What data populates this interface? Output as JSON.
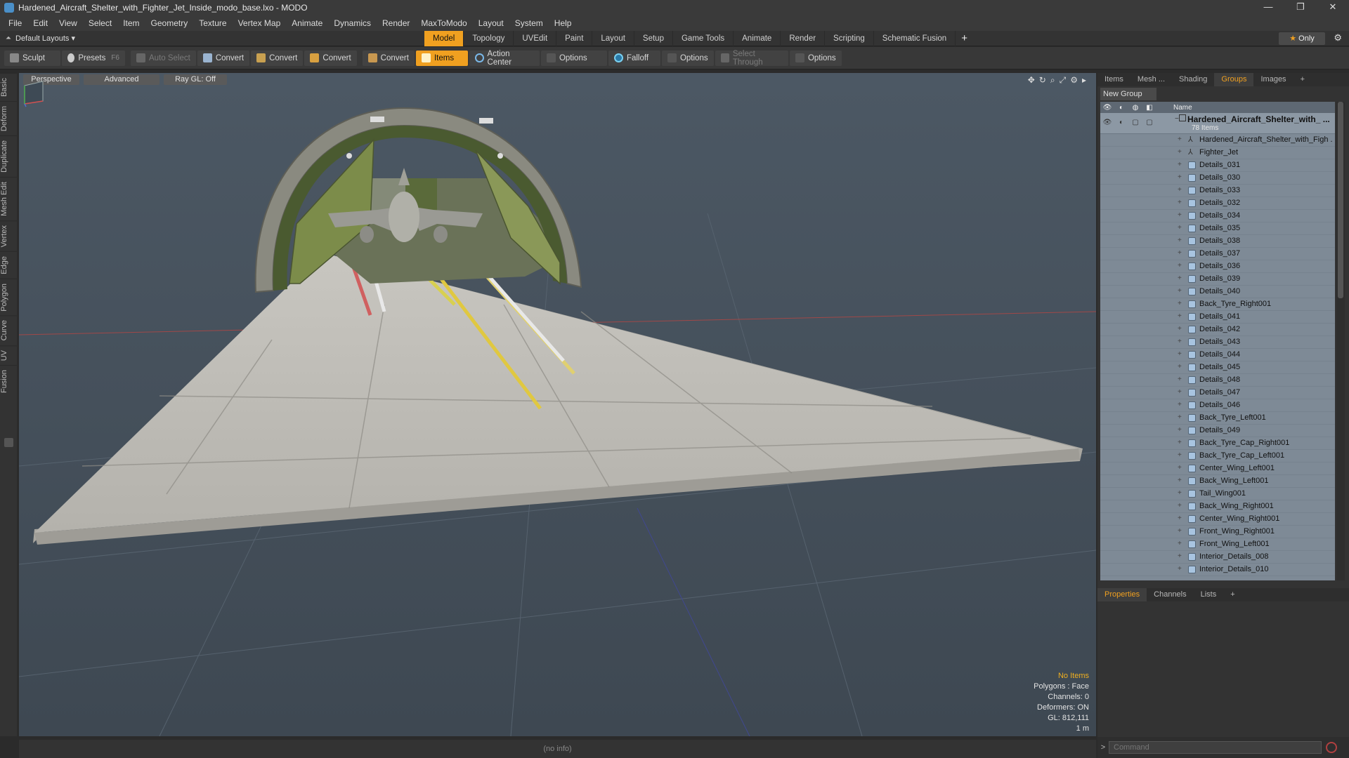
{
  "window": {
    "title": "Hardened_Aircraft_Shelter_with_Fighter_Jet_Inside_modo_base.lxo - MODO",
    "controls": [
      "—",
      "❐",
      "✕"
    ]
  },
  "menu": [
    "File",
    "Edit",
    "View",
    "Select",
    "Item",
    "Geometry",
    "Texture",
    "Vertex Map",
    "Animate",
    "Dynamics",
    "Render",
    "MaxToModo",
    "Layout",
    "System",
    "Help"
  ],
  "layoutbar": {
    "layout_name": "Default Layouts ▾",
    "tabs": [
      "Model",
      "Topology",
      "UVEdit",
      "Paint",
      "Layout",
      "Setup",
      "Game Tools",
      "Animate",
      "Render",
      "Scripting",
      "Schematic Fusion"
    ],
    "active_tab": "Model",
    "only_label": "Only"
  },
  "toolbar": {
    "sculpt": "Sculpt",
    "presets": "Presets",
    "presets_hotkey": "F6",
    "auto_select": "Auto Select",
    "convert1": "Convert",
    "convert2": "Convert",
    "convert3": "Convert",
    "convert4": "Convert",
    "items": "Items",
    "action_center": "Action Center",
    "options1": "Options",
    "falloff": "Falloff",
    "options2": "Options",
    "select_through": "Select Through",
    "options3": "Options"
  },
  "left_tabs": [
    "Basic",
    "Deform",
    "Duplicate",
    "Mesh Edit",
    "Vertex",
    "Edge",
    "Polygon",
    "Curve",
    "UV",
    "Fusion"
  ],
  "viewport": {
    "view_mode": "Perspective",
    "shading": "Advanced",
    "raygl": "Ray GL: Off",
    "info": {
      "selection": "No Items",
      "polygons": "Polygons : Face",
      "channels": "Channels: 0",
      "deformers": "Deformers: ON",
      "gl": "GL: 812,111",
      "scale": "1 m"
    }
  },
  "statusbar": "(no info)",
  "right_panel": {
    "tabs": [
      "Items",
      "Mesh ...",
      "Shading",
      "Groups",
      "Images"
    ],
    "active_tab": "Groups",
    "new_group": "New Group",
    "column_name": "Name",
    "group": {
      "name": "Hardened_Aircraft_Shelter_with_ ...",
      "count": "78 Items"
    },
    "items": [
      "Hardened_Aircraft_Shelter_with_Figh ...",
      "Fighter_Jet",
      "Details_031",
      "Details_030",
      "Details_033",
      "Details_032",
      "Details_034",
      "Details_035",
      "Details_038",
      "Details_037",
      "Details_036",
      "Details_039",
      "Details_040",
      "Back_Tyre_Right001",
      "Details_041",
      "Details_042",
      "Details_043",
      "Details_044",
      "Details_045",
      "Details_048",
      "Details_047",
      "Details_046",
      "Back_Tyre_Left001",
      "Details_049",
      "Back_Tyre_Cap_Right001",
      "Back_Tyre_Cap_Left001",
      "Center_Wing_Left001",
      "Back_Wing_Left001",
      "Tail_Wing001",
      "Back_Wing_Right001",
      "Center_Wing_Right001",
      "Front_Wing_Right001",
      "Front_Wing_Left001",
      "Interior_Details_008",
      "Interior_Details_010"
    ],
    "props_tabs": [
      "Properties",
      "Channels",
      "Lists"
    ],
    "props_active": "Properties",
    "command_placeholder": "Command"
  },
  "colors": {
    "accent": "#f0a020",
    "viewport_bg": "#46525e",
    "list_bg": "#7e8a96"
  }
}
